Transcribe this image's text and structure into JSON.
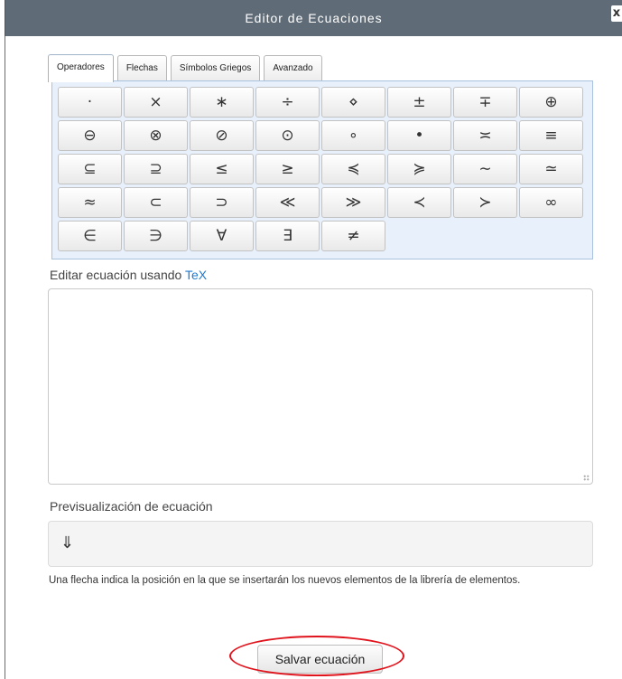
{
  "window": {
    "title": "Editor de Ecuaciones",
    "close_glyph": "x"
  },
  "tabs": [
    {
      "label": "Operadores",
      "active": true
    },
    {
      "label": "Flechas",
      "active": false
    },
    {
      "label": "Símbolos Griegos",
      "active": false
    },
    {
      "label": "Avanzado",
      "active": false
    }
  ],
  "symbols": [
    "·",
    "×",
    "∗",
    "÷",
    "⋄",
    "±",
    "∓",
    "⊕",
    "⊖",
    "⊗",
    "⊘",
    "⊙",
    "∘",
    "•",
    "≍",
    "≡",
    "⊆",
    "⊇",
    "≤",
    "≥",
    "≼",
    "≽",
    "∼",
    "≃",
    "≈",
    "⊂",
    "⊃",
    "≪",
    "≫",
    "≺",
    "≻",
    "∞",
    "∈",
    "∋",
    "∀",
    "∃",
    "≠"
  ],
  "tex_section": {
    "label_prefix": "Editar ecuación usando ",
    "label_link": "TeX",
    "value": ""
  },
  "preview": {
    "label": "Previsualización de ecuación",
    "cursor_glyph": "⇓",
    "help_text": "Una flecha indica la posición en la que se insertarán los nuevos elementos de la librería de elementos."
  },
  "actions": {
    "save_label": "Salvar ecuación"
  },
  "colors": {
    "titlebar": "#5f6b76",
    "highlight": "#e0141d",
    "link": "#1f7ad1",
    "panel": "#e8f1fb"
  }
}
